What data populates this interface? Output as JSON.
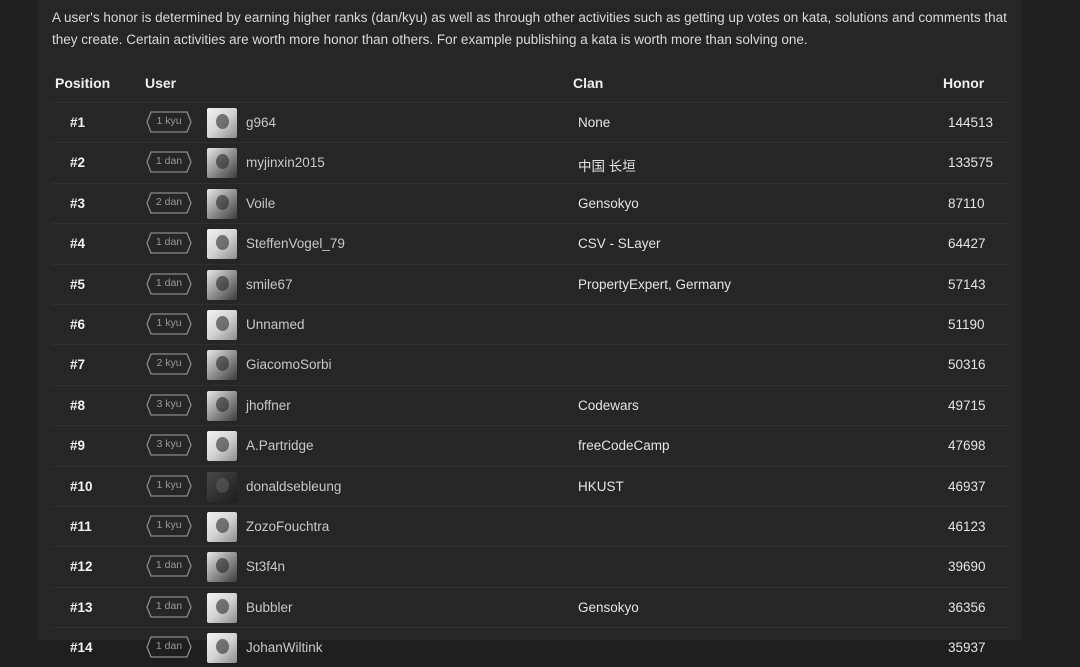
{
  "intro_text": "A user's honor is determined by earning higher ranks (dan/kyu) as well as through other activities such as getting up votes on kata, solutions and comments that they create. Certain activities are worth more honor than others. For example publishing a kata is worth more than solving one.",
  "headers": {
    "position": "Position",
    "user": "User",
    "clan": "Clan",
    "honor": "Honor"
  },
  "rows": [
    {
      "position": "#1",
      "rank": "1 kyu",
      "user": "g964",
      "clan": "None",
      "honor": "144513"
    },
    {
      "position": "#2",
      "rank": "1 dan",
      "user": "myjinxin2015",
      "clan": "中国 长垣",
      "honor": "133575"
    },
    {
      "position": "#3",
      "rank": "2 dan",
      "user": "Voile",
      "clan": "Gensokyo",
      "honor": "87110"
    },
    {
      "position": "#4",
      "rank": "1 dan",
      "user": "SteffenVogel_79",
      "clan": "CSV - SLayer",
      "honor": "64427"
    },
    {
      "position": "#5",
      "rank": "1 dan",
      "user": "smile67",
      "clan": "PropertyExpert, Germany",
      "honor": "57143"
    },
    {
      "position": "#6",
      "rank": "1 kyu",
      "user": "Unnamed",
      "clan": "",
      "honor": "51190"
    },
    {
      "position": "#7",
      "rank": "2 kyu",
      "user": "GiacomoSorbi",
      "clan": "",
      "honor": "50316"
    },
    {
      "position": "#8",
      "rank": "3 kyu",
      "user": "jhoffner",
      "clan": "Codewars",
      "honor": "49715"
    },
    {
      "position": "#9",
      "rank": "3 kyu",
      "user": "A.Partridge",
      "clan": "freeCodeCamp",
      "honor": "47698"
    },
    {
      "position": "#10",
      "rank": "1 kyu",
      "user": "donaldsebleung",
      "clan": "HKUST",
      "honor": "46937"
    },
    {
      "position": "#11",
      "rank": "1 kyu",
      "user": "ZozoFouchtra",
      "clan": "",
      "honor": "46123"
    },
    {
      "position": "#12",
      "rank": "1 dan",
      "user": "St3f4n",
      "clan": "",
      "honor": "39690"
    },
    {
      "position": "#13",
      "rank": "1 dan",
      "user": "Bubbler",
      "clan": "Gensokyo",
      "honor": "36356"
    },
    {
      "position": "#14",
      "rank": "1 dan",
      "user": "JohanWiltink",
      "clan": "",
      "honor": "35937"
    }
  ]
}
